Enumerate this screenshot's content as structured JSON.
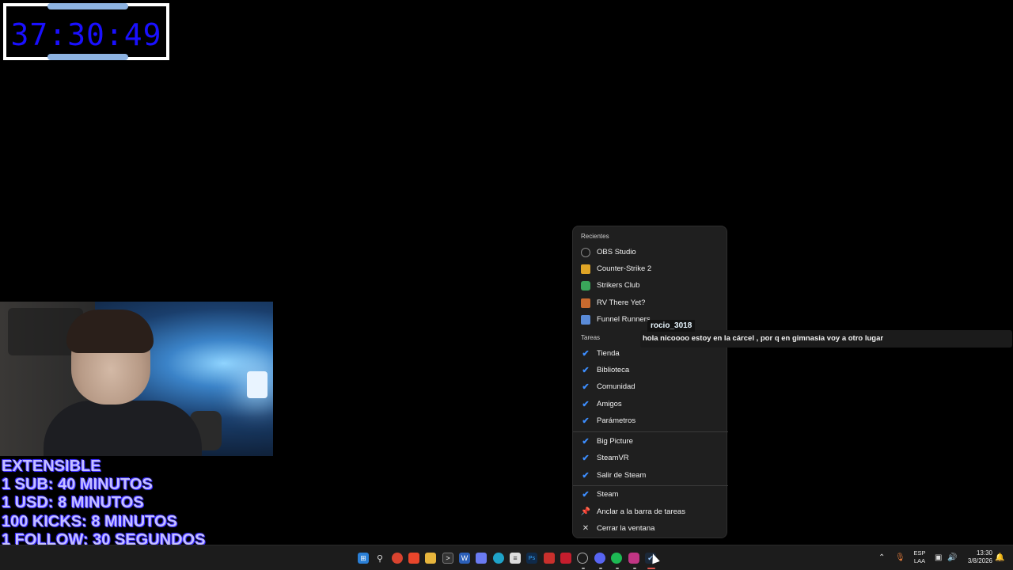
{
  "timer": {
    "value": "37:30:49"
  },
  "subathon": {
    "lines": [
      "EXTENSIBLE",
      "1 SUB: 40 MINUTOS",
      "1 USD: 8 MINUTOS",
      "100 KICKS: 8 MINUTOS",
      "1 FOLLOW: 30 SEGUNDOS"
    ]
  },
  "jumplist": {
    "recent_header": "Recientes",
    "recent": [
      {
        "label": "OBS Studio",
        "icon": "obs-icon"
      },
      {
        "label": "Counter-Strike 2",
        "icon": "cs2-icon"
      },
      {
        "label": "Strikers Club",
        "icon": "strikers-club-icon"
      },
      {
        "label": "RV There Yet?",
        "icon": "rv-there-yet-icon"
      },
      {
        "label": "Funnel Runners",
        "icon": "funnel-runners-icon"
      }
    ],
    "tasks_header": "Tareas",
    "tasks": [
      {
        "label": "Tienda",
        "icon": "steam-icon"
      },
      {
        "label": "Biblioteca",
        "icon": "steam-icon"
      },
      {
        "label": "Comunidad",
        "icon": "steam-icon"
      },
      {
        "label": "Amigos",
        "icon": "steam-icon"
      },
      {
        "label": "Parámetros",
        "icon": "steam-icon"
      }
    ],
    "steam_actions": [
      {
        "label": "Big Picture",
        "icon": "steam-icon"
      },
      {
        "label": "SteamVR",
        "icon": "steam-icon"
      },
      {
        "label": "Salir de Steam",
        "icon": "steam-icon"
      }
    ],
    "app_actions": [
      {
        "label": "Steam",
        "icon": "steam-icon"
      },
      {
        "label": "Anclar a la barra de tareas",
        "icon": "pin-icon"
      },
      {
        "label": "Cerrar la ventana",
        "icon": "close-icon"
      }
    ]
  },
  "chat": {
    "username": "rocio_3018",
    "message": "hola nicoooo estoy en la cárcel , por q en gimnasia voy a otro lugar"
  },
  "taskbar": {
    "apps": [
      "windows-start-icon",
      "search-icon",
      "chrome-icon",
      "brave-icon",
      "file-explorer-icon",
      "terminal-icon",
      "word-icon",
      "copilot-icon",
      "edge-icon",
      "notepad-icon",
      "photoshop-icon",
      "adobe-icon",
      "kick-icon",
      "obs-icon",
      "discord-icon",
      "spotify-icon",
      "instagram-icon",
      "steam-icon"
    ],
    "lang_top": "ESP",
    "lang_bottom": "LAA",
    "time": "13:30",
    "date": "3/8/2026"
  }
}
